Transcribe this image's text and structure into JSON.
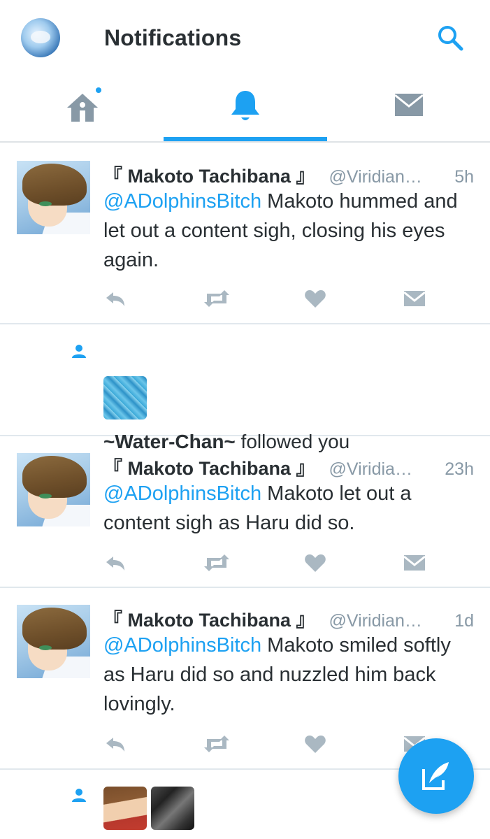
{
  "header": {
    "title": "Notifications"
  },
  "tabs": [
    {
      "id": "home",
      "icon": "home-icon",
      "has_new": true,
      "selected": false
    },
    {
      "id": "notifications",
      "icon": "bell-icon",
      "selected": true
    },
    {
      "id": "messages",
      "icon": "envelope-icon",
      "selected": false
    }
  ],
  "colors": {
    "accent": "#1da1f2",
    "text": "#292f33",
    "muted": "#8899a6",
    "icon": "#aab8c2",
    "divider": "#e1e8ed"
  },
  "feed": [
    {
      "type": "tweet",
      "name": "『 Makoto Tachibana 』",
      "handle": "@Viridian…",
      "time": "5h",
      "mention": "@ADolphinsBitch",
      "text": " Makoto hummed and let out a content sigh, closing his eyes again."
    },
    {
      "type": "follow",
      "follower": "~Water-Chan~",
      "action": " followed you"
    },
    {
      "type": "tweet",
      "name": "『 Makoto Tachibana 』",
      "handle": "@Viridia…",
      "time": "23h",
      "mention": "@ADolphinsBitch",
      "text": " Makoto let out a content sigh as Haru did so."
    },
    {
      "type": "tweet",
      "name": "『 Makoto Tachibana 』",
      "handle": "@Viridian…",
      "time": "1d",
      "mention": "@ADolphinsBitch",
      "text": " Makoto smiled softly as Haru did so and nuzzled him back lovingly."
    },
    {
      "type": "follow",
      "avatars": 2
    }
  ],
  "actions": [
    "reply-icon",
    "retweet-icon",
    "heart-icon",
    "direct-message-icon"
  ],
  "fab": {
    "icon": "compose-tweet-icon"
  }
}
